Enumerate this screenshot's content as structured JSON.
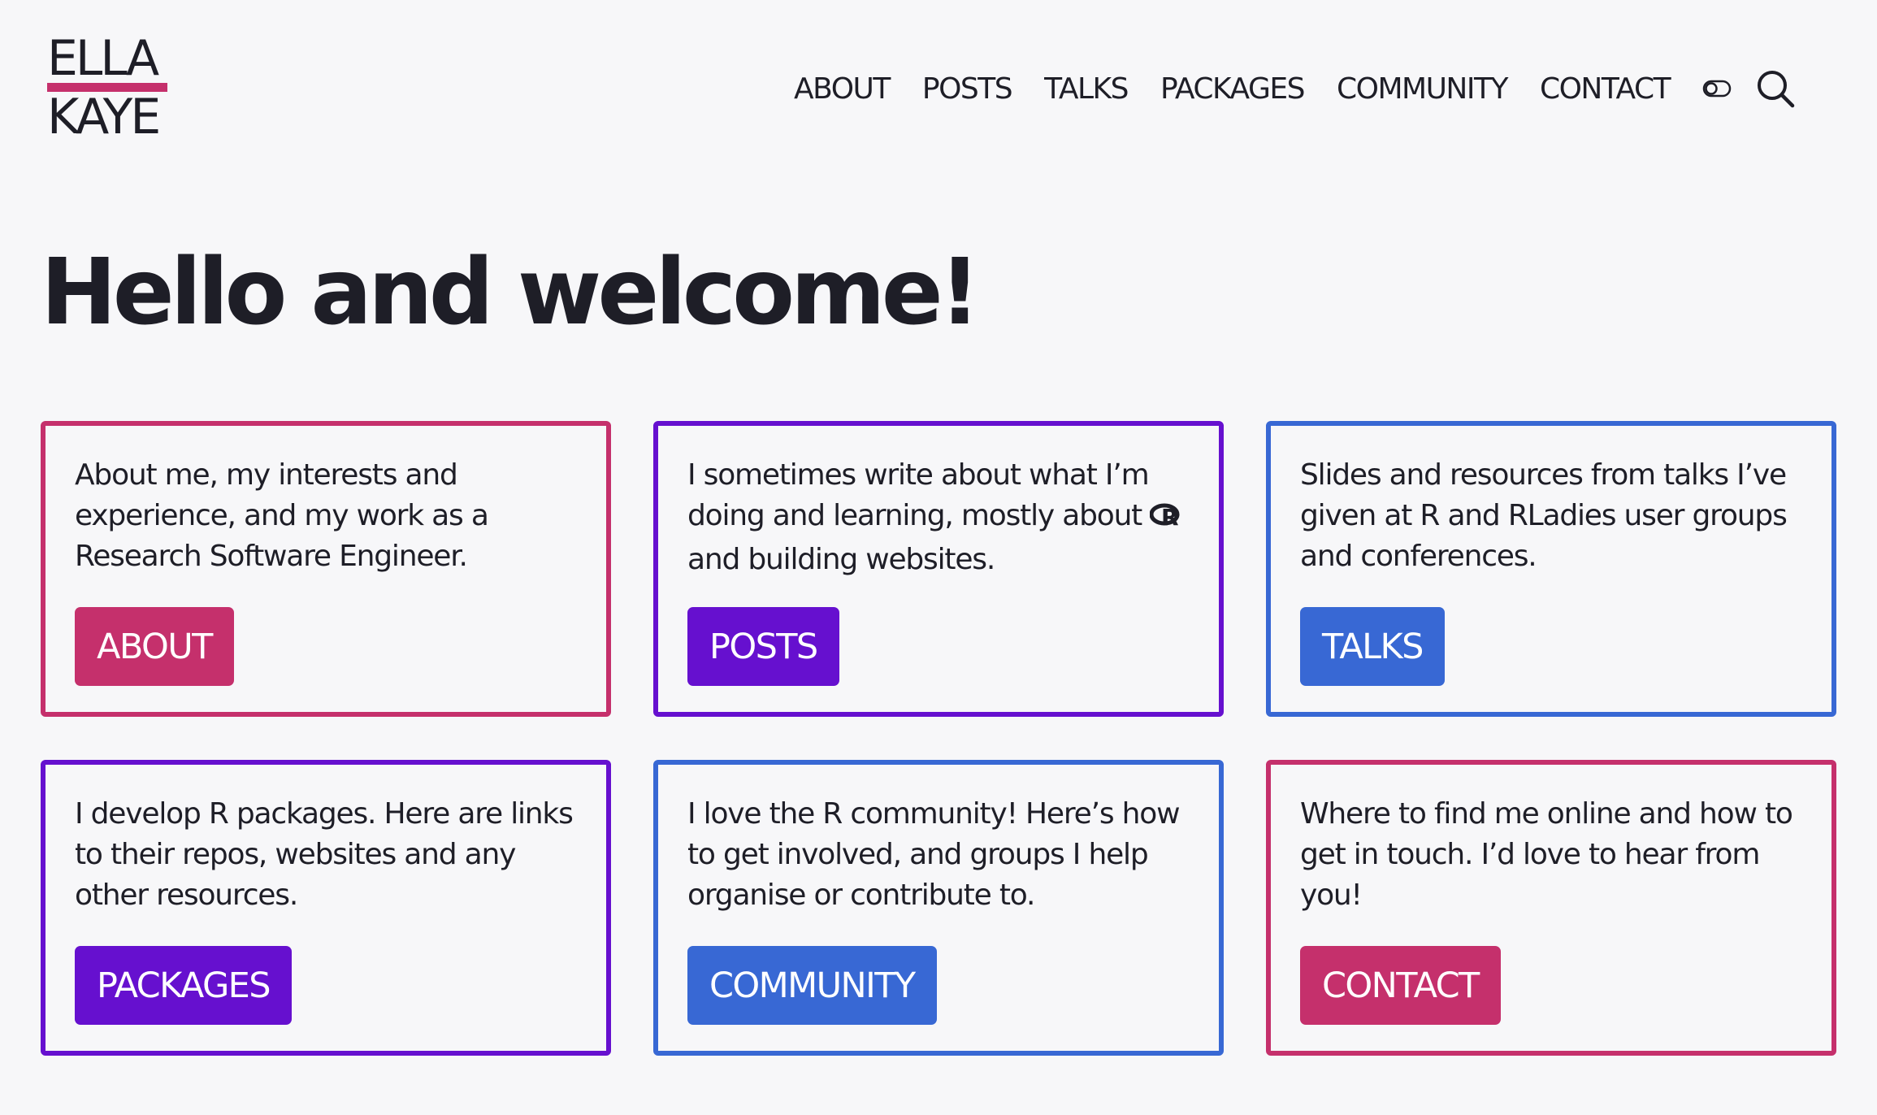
{
  "logo": {
    "line1": "ELLA",
    "line2": "KAYE",
    "bar_color": "#c5306c"
  },
  "nav": {
    "items": [
      "ABOUT",
      "POSTS",
      "TALKS",
      "PACKAGES",
      "COMMUNITY",
      "CONTACT"
    ],
    "icons": [
      "toggle-icon",
      "search-icon"
    ]
  },
  "page_title": "Hello and welcome!",
  "cards": [
    {
      "text": "About me, my interests and experience, and my work as a Research Software Engineer.",
      "button": "ABOUT",
      "color": "#c5306c"
    },
    {
      "text_before_icon": "I sometimes write about what I’m doing and learning, mostly about ",
      "text_after_icon": "and building websites.",
      "icon": "r-logo-icon",
      "button": "POSTS",
      "color": "#6610cf"
    },
    {
      "text": "Slides and resources from talks I’ve given at R and RLadies user groups and conferences.",
      "button": "TALKS",
      "color": "#3868d4"
    },
    {
      "text": "I develop R packages. Here are links to their repos, websites and any other resources.",
      "button": "PACKAGES",
      "color": "#6610cf"
    },
    {
      "text": "I love the R community! Here’s how to get involved, and groups I help organise or contribute to.",
      "button": "COMMUNITY",
      "color": "#3868d4"
    },
    {
      "text": "Where to find me online and how to get in touch. I’d love to hear from you!",
      "button": "CONTACT",
      "color": "#c5306c"
    }
  ]
}
